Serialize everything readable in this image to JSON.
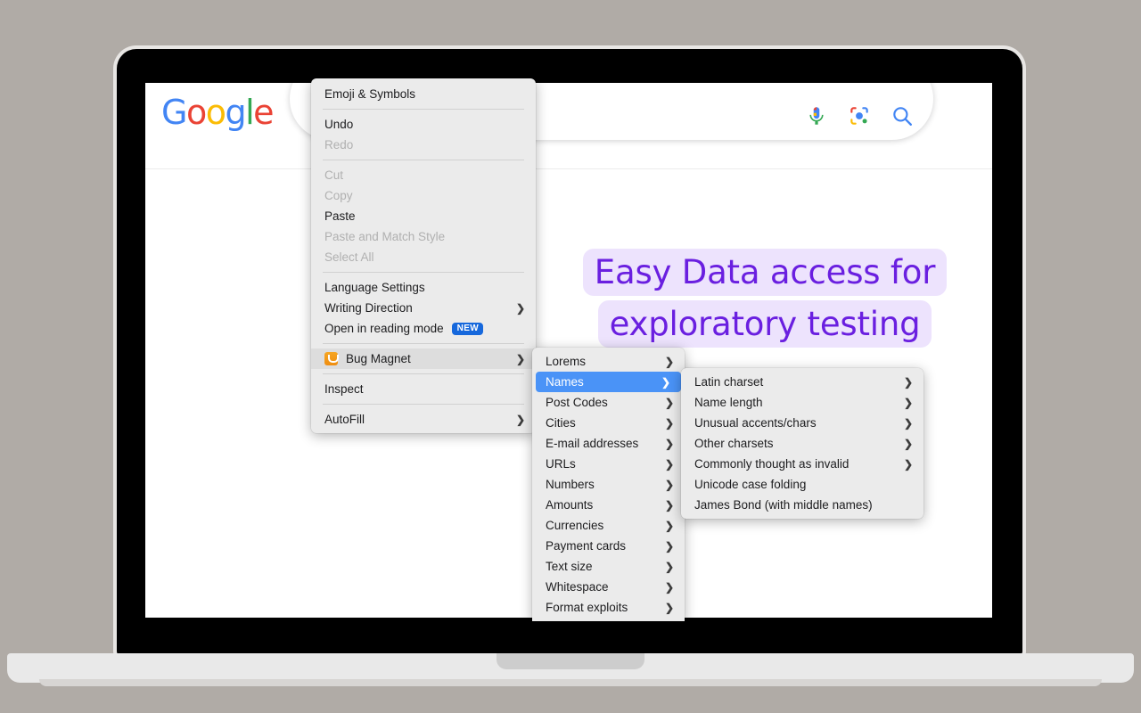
{
  "page": {
    "logo_letters": [
      "G",
      "o",
      "o",
      "g",
      "l",
      "e"
    ],
    "hero_line1": "Easy Data access for",
    "hero_line2": "exploratory testing",
    "hero_color": "#6A1FE0",
    "hero_highlight_color": "#EDE3FD",
    "search_placeholder": "",
    "search_value": ""
  },
  "header_icons": [
    {
      "name": "voice-search-icon",
      "label": "Search by voice"
    },
    {
      "name": "google-lens-icon",
      "label": "Search by image"
    },
    {
      "name": "search-icon",
      "label": "Google Search"
    }
  ],
  "context_menu": {
    "items": [
      {
        "label": "Emoji & Symbols",
        "state": "enabled",
        "submenu": false
      },
      {
        "type": "separator"
      },
      {
        "label": "Undo",
        "state": "enabled",
        "submenu": false
      },
      {
        "label": "Redo",
        "state": "disabled",
        "submenu": false
      },
      {
        "type": "separator"
      },
      {
        "label": "Cut",
        "state": "disabled",
        "submenu": false
      },
      {
        "label": "Copy",
        "state": "disabled",
        "submenu": false
      },
      {
        "label": "Paste",
        "state": "enabled",
        "submenu": false
      },
      {
        "label": "Paste and Match Style",
        "state": "disabled",
        "submenu": false
      },
      {
        "label": "Select All",
        "state": "disabled",
        "submenu": false
      },
      {
        "type": "separator"
      },
      {
        "label": "Language Settings",
        "state": "enabled",
        "submenu": false
      },
      {
        "label": "Writing Direction",
        "state": "enabled",
        "submenu": true
      },
      {
        "label": "Open in reading mode",
        "state": "enabled",
        "submenu": false,
        "badge": "NEW"
      },
      {
        "type": "separator"
      },
      {
        "label": "Bug Magnet",
        "state": "enabled",
        "submenu": true,
        "highlighted": true,
        "icon": "bug-magnet-icon"
      },
      {
        "type": "separator"
      },
      {
        "label": "Inspect",
        "state": "enabled",
        "submenu": false
      },
      {
        "type": "separator"
      },
      {
        "label": "AutoFill",
        "state": "enabled",
        "submenu": true
      }
    ]
  },
  "bug_magnet_menu": {
    "items": [
      {
        "label": "Lorems",
        "submenu": true
      },
      {
        "label": "Names",
        "submenu": true,
        "selected": true
      },
      {
        "label": "Post Codes",
        "submenu": true
      },
      {
        "label": "Cities",
        "submenu": true
      },
      {
        "label": "E-mail addresses",
        "submenu": true
      },
      {
        "label": "URLs",
        "submenu": true
      },
      {
        "label": "Numbers",
        "submenu": true
      },
      {
        "label": "Amounts",
        "submenu": true
      },
      {
        "label": "Currencies",
        "submenu": true
      },
      {
        "label": "Payment cards",
        "submenu": true
      },
      {
        "label": "Text size",
        "submenu": true
      },
      {
        "label": "Whitespace",
        "submenu": true
      },
      {
        "label": "Format exploits",
        "submenu": true
      }
    ]
  },
  "names_menu": {
    "items": [
      {
        "label": "Latin charset",
        "submenu": true
      },
      {
        "label": "Name length",
        "submenu": true
      },
      {
        "label": "Unusual accents/chars",
        "submenu": true
      },
      {
        "label": "Other charsets",
        "submenu": true
      },
      {
        "label": "Commonly thought as invalid",
        "submenu": true
      },
      {
        "label": "Unicode case folding",
        "submenu": false
      },
      {
        "label": "James Bond (with middle names)",
        "submenu": false
      }
    ]
  }
}
